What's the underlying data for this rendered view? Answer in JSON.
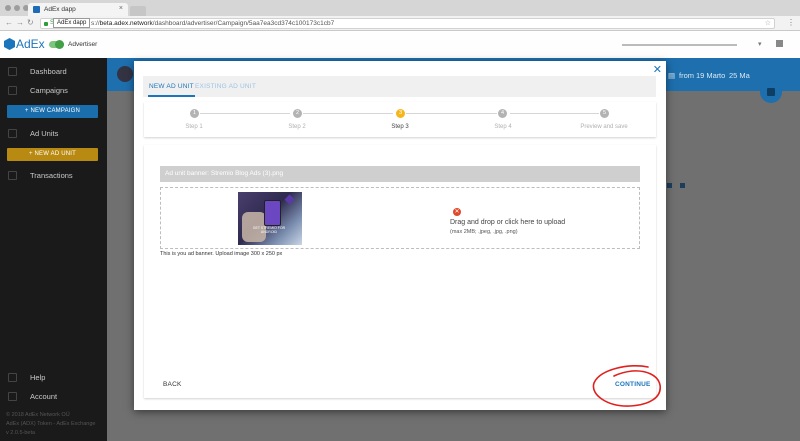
{
  "browser": {
    "tab_title": "AdEx dapp",
    "tooltip": "AdEx dapp",
    "secure_label": "Se",
    "url_prefix": "s://",
    "url_host": "beta.adex.network",
    "url_path": "/dashboard/advertiser/Campaign/5aa7ea3cd374c100173c1cb7"
  },
  "app": {
    "brand": "AdEx",
    "role": "Advertiser"
  },
  "sidebar": {
    "items": [
      {
        "label": "Dashboard"
      },
      {
        "label": "Campaigns"
      },
      {
        "label": "Ad Units"
      },
      {
        "label": "Transactions"
      },
      {
        "label": "Help"
      },
      {
        "label": "Account"
      }
    ],
    "new_campaign": "+    NEW CAMPAIGN",
    "new_ad_unit": "+    NEW AD UNIT",
    "footer": [
      "© 2018 AdEx Network OÜ",
      "AdEx (ADX) Token - AdEx Exchange",
      "v 2.0.5-beta"
    ]
  },
  "banner": {
    "from_label": "from",
    "from_date": "19 Mar",
    "to_label": "to",
    "to_date": "25 Ma"
  },
  "modal": {
    "close": "✕",
    "tabs": [
      {
        "label": "NEW AD UNIT",
        "active": true
      },
      {
        "label": "EXISTING AD UNIT",
        "active": false
      }
    ],
    "steps": [
      {
        "num": "1",
        "label": "Step 1"
      },
      {
        "num": "2",
        "label": "Step 2"
      },
      {
        "num": "3",
        "label": "Step 3",
        "active": true
      },
      {
        "num": "4",
        "label": "Step 4"
      },
      {
        "num": "5",
        "label": "Preview and save"
      }
    ],
    "banner_title": "Ad unit banner: Stremio Blog Ads (3).png",
    "thumbnail_caption": "GET STREMIO FOR ANDROID",
    "drop_text": "Drag and drop or click here to upload",
    "drop_sub": "(max 2MB; .jpeg, .jpg, .png)",
    "hint": "This is you ad banner. Upload image 300 x 250 px",
    "back": "BACK",
    "continue": "CONTINUE"
  },
  "colors": {
    "accent": "#1b75bc",
    "warning": "#f5b619",
    "error": "#e0482a",
    "annotation": "#e0201e"
  }
}
